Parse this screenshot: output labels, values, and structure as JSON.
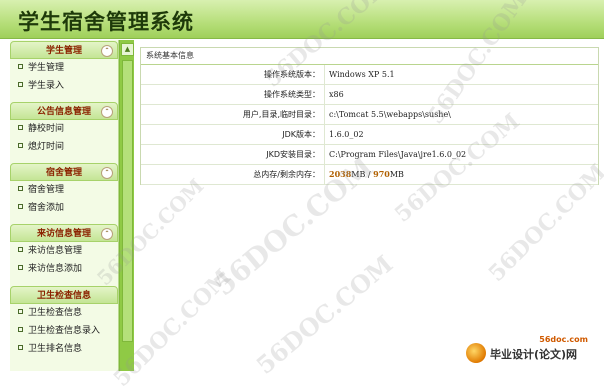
{
  "app": {
    "title": "学生宿舍管理系统"
  },
  "sidebar": {
    "groups": [
      {
        "title": "学生管理",
        "items": [
          "学生管理",
          "学生录入"
        ]
      },
      {
        "title": "公告信息管理",
        "items": [
          "静校时间",
          "熄灯时间"
        ]
      },
      {
        "title": "宿舍管理",
        "items": [
          "宿舍管理",
          "宿舍添加"
        ]
      },
      {
        "title": "来访信息管理",
        "items": [
          "来访信息管理",
          "来访信息添加"
        ]
      },
      {
        "title": "卫生检查信息",
        "items": [
          "卫生检查信息",
          "卫生检查信息录入",
          "卫生排名信息"
        ]
      }
    ]
  },
  "content": {
    "title": "系统基本信息",
    "rows": [
      {
        "label": "操作系统版本：",
        "value": "Windows XP 5.1"
      },
      {
        "label": "操作系统类型：",
        "value": "x86"
      },
      {
        "label": "用户,目录,临时目录：",
        "value": "c:\\Tomcat 5.5\\webapps\\sushe\\"
      },
      {
        "label": "JDK版本：",
        "value": "1.6.0_02"
      },
      {
        "label": "JKD安装目录：",
        "value": "C:\\Program Files\\Java\\jre1.6.0_02"
      },
      {
        "label": "总内存/剩余内存：",
        "total": "2038",
        "unit": "MB",
        "sep": "/",
        "free": "970",
        "unit2": "MB"
      }
    ]
  },
  "watermarks": [
    "56DOC.COM"
  ],
  "brand": {
    "site": "56doc.com",
    "name": "毕业设计(论文)网"
  }
}
